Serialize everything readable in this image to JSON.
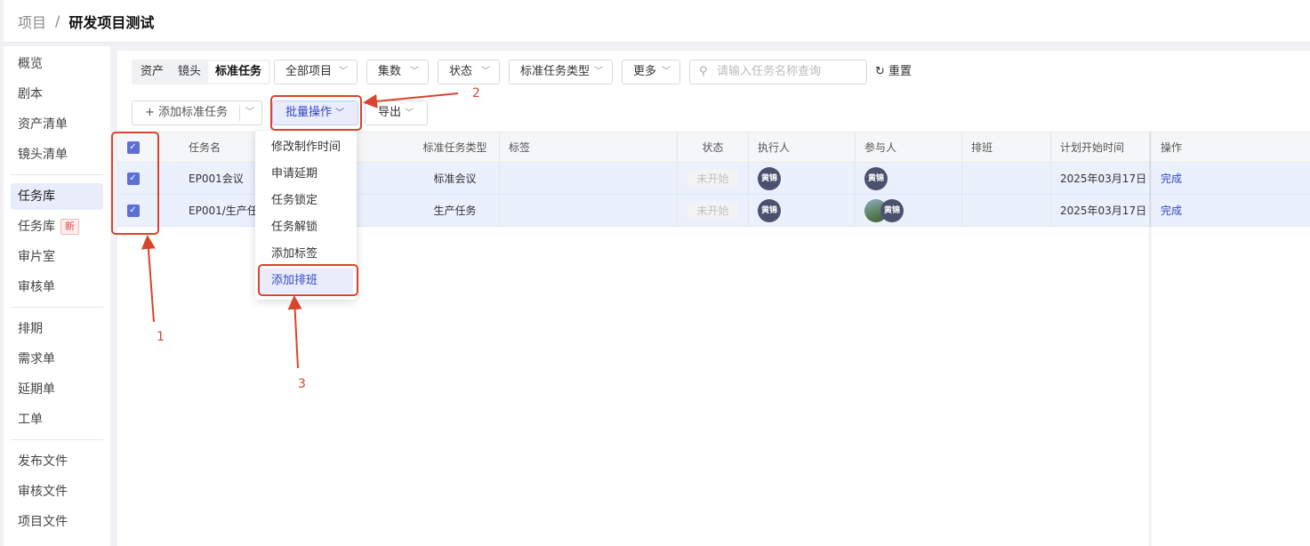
{
  "breadcrumb": {
    "root": "项目",
    "separator": "/",
    "current": "研发项目测试"
  },
  "sidebar": {
    "items": [
      {
        "label": "概览"
      },
      {
        "label": "剧本"
      },
      {
        "label": "资产清单"
      },
      {
        "label": "镜头清单"
      },
      {
        "label": "任务库",
        "active": true
      },
      {
        "label": "任务库",
        "badge": "新"
      },
      {
        "label": "审片室"
      },
      {
        "label": "审核单"
      },
      {
        "label": "排期"
      },
      {
        "label": "需求单"
      },
      {
        "label": "延期单"
      },
      {
        "label": "工单"
      },
      {
        "label": "发布文件"
      },
      {
        "label": "审核文件"
      },
      {
        "label": "项目文件"
      }
    ]
  },
  "filters": {
    "tabs": [
      "资产",
      "镜头",
      "标准任务"
    ],
    "active_tab": "标准任务",
    "dropdowns": [
      "全部项目",
      "集数",
      "状态",
      "标准任务类型",
      "更多"
    ],
    "search_placeholder": "请输入任务名称查询",
    "reset_label": "重置"
  },
  "toolbar": {
    "add_label": "+ 添加标准任务",
    "batch_label": "批量操作",
    "export_label": "导出"
  },
  "table": {
    "columns": [
      "任务名",
      "标准任务类型",
      "标签",
      "状态",
      "执行人",
      "参与人",
      "排班",
      "计划开始时间",
      "操作"
    ],
    "rows": [
      {
        "name": "EP001会议",
        "type": "标准会议",
        "tag": "",
        "status": "未开始",
        "executor": "黄锦",
        "participant": "黄锦",
        "schedule": "",
        "start": "2025年03月17日",
        "action": "完成"
      },
      {
        "name": "EP001/生产任",
        "type": "生产任务",
        "tag": "",
        "status": "未开始",
        "executor": "黄锦",
        "participant": "黄锦",
        "schedule": "",
        "start": "2025年03月17日",
        "action": "完成"
      }
    ]
  },
  "batch_menu": {
    "items": [
      "修改制作时间",
      "申请延期",
      "任务锁定",
      "任务解锁",
      "添加标签",
      "添加排班"
    ],
    "highlighted": "添加排班"
  },
  "annotations": {
    "label1": "1",
    "label2": "2",
    "label3": "3",
    "color": "#d9442c"
  },
  "colors": {
    "accent": "#3448c5",
    "row_selected": "#eaf0fc",
    "annotation": "#d9442c"
  }
}
